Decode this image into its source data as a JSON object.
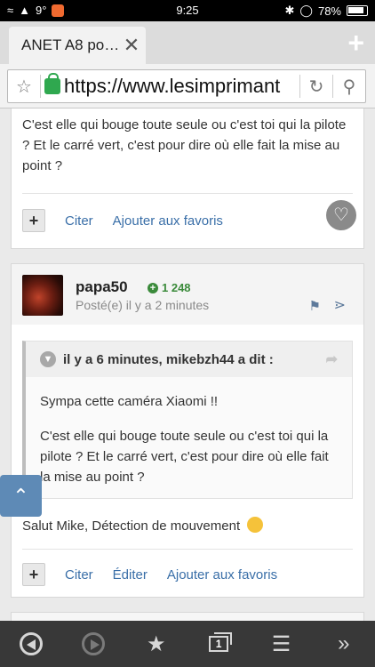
{
  "status_bar": {
    "left_signal": "9°",
    "time": "9:25",
    "battery": "78%"
  },
  "browser": {
    "tab_title": "ANET A8 po…",
    "url": "https://www.lesimprimant",
    "new_tab_label": "+"
  },
  "post1": {
    "text": "C'est elle qui bouge toute seule ou c'est toi qui la pilote ? Et le carré vert, c'est pour dire où elle fait la mise au point ?",
    "actions": {
      "quote_label": "Citer",
      "favorite_label": "Ajouter aux favoris"
    }
  },
  "post2": {
    "author": "papa50",
    "reputation": "1 248",
    "posted": "Posté(e) il y a 2 minutes",
    "quote": {
      "header": "il y a 6 minutes, mikebzh44 a dit :",
      "line1": "Sympa cette caméra Xiaomi !!",
      "line2": "C'est elle qui bouge toute seule ou c'est toi qui la pilote ? Et le carré vert, c'est pour dire où elle fait la mise au point ?"
    },
    "reply": "Salut Mike, Détection de mouvement",
    "actions": {
      "quote_label": "Citer",
      "edit_label": "Éditer",
      "favorite_label": "Ajouter aux favoris"
    }
  },
  "toolbar": {
    "tab_count": "1"
  },
  "icons": {
    "accent": "#3a6fa8",
    "rep_color": "#3a8a3a",
    "scroll_top": "#5e8ab6"
  }
}
